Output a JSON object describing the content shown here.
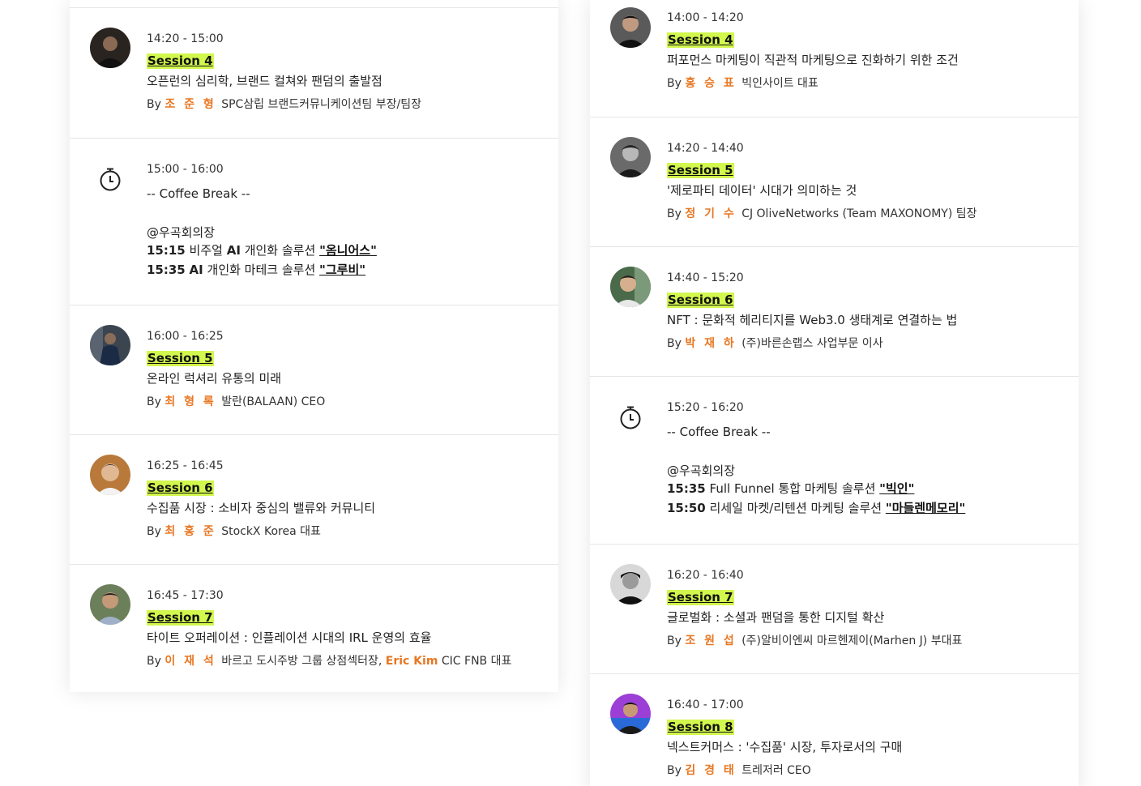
{
  "left": {
    "items": [
      {
        "time": "14:20 - 15:00",
        "session": "Session 4",
        "title": "오픈런의 심리학, 브랜드 컬쳐와 팬덤의 출발점",
        "by": "By",
        "speaker": "조 준 형",
        "role": "SPC삼립 브랜드커뮤니케이션팀 부장/팀장",
        "avatar_bg": "#2a2420"
      },
      {
        "time": "16:00 - 16:25",
        "session": "Session 5",
        "title": "온라인 럭셔리 유통의 미래",
        "by": "By",
        "speaker": "최 형 록",
        "role": "발란(BALAAN) CEO",
        "avatar_bg": "#3b4550"
      },
      {
        "time": "16:25 - 16:45",
        "session": "Session 6",
        "title": "수집품 시장 : 소비자 중심의 밸류와 커뮤니티",
        "by": "By",
        "speaker": "최 홍 준",
        "role": "StockX Korea 대표",
        "avatar_bg": "#b8793a"
      },
      {
        "time": "16:45 - 17:30",
        "session": "Session 7",
        "title": "타이트 오퍼레이션 : 인플레이션 시대의 IRL 운영의 효율",
        "by": "By",
        "speaker": "이 재 석",
        "role": "바르고 도시주방 그룹 상점섹터장,",
        "speaker2": "Eric Kim",
        "role2": "CIC FNB 대표",
        "avatar_bg": "#6b7f5a"
      }
    ],
    "break": {
      "time": "15:00 - 16:00",
      "title": "-- Coffee Break --",
      "venue": "@우곡회의장",
      "promos": [
        {
          "time": "15:15",
          "text_pre": "비주얼",
          "tm": "AI",
          "text_post": "개인화 솔루션",
          "link": "\"옴니어스\""
        },
        {
          "time": "15:35",
          "text_pre": "",
          "tm": "AI",
          "text_post": "개인화 마테크 솔루션",
          "link": "\"그루비\""
        }
      ]
    }
  },
  "right": {
    "items": [
      {
        "time": "14:00 - 14:20",
        "session": "Session 4",
        "title": "퍼포먼스 마케팅이 직관적 마케팅으로 진화하기 위한 조건",
        "by": "By",
        "speaker": "홍 승 표",
        "role": "빅인사이트 대표",
        "avatar_bg": "#2b2b2b"
      },
      {
        "time": "14:20 - 14:40",
        "session": "Session 5",
        "title": "'제로파티 데이터' 시대가 의미하는 것",
        "by": "By",
        "speaker": "정 기 수",
        "role": "CJ OliveNetworks (Team MAXONOMY) 팀장",
        "avatar_bg": "#3a3a3a"
      },
      {
        "time": "14:40 - 15:20",
        "session": "Session 6",
        "title": "NFT : 문화적 헤리티지를 Web3.0 생태계로 연결하는 법",
        "by": "By",
        "speaker": "박 재 하",
        "role": "(주)바른손랩스 사업부문 이사",
        "avatar_bg": "#4a6a4a"
      },
      {
        "time": "16:20 - 16:40",
        "session": "Session 7",
        "title": "글로벌화 : 소셜과 팬덤을 통한 디지털 확산",
        "by": "By",
        "speaker": "조 원 섭",
        "role": "(주)알비이엔씨 마르헨제이(Marhen J) 부대표",
        "avatar_bg": "#d8d8d8"
      },
      {
        "time": "16:40 - 17:00",
        "session": "Session 8",
        "title": "넥스트커머스 : '수집품' 시장, 투자로서의 구매",
        "by": "By",
        "speaker": "김 경 태",
        "role": "트레저러 CEO",
        "avatar_bg": "#9b3fd6"
      }
    ],
    "break": {
      "time": "15:20 - 16:20",
      "title": "-- Coffee Break --",
      "venue": "@우곡회의장",
      "promos": [
        {
          "time": "15:35",
          "text": "Full Funnel 통합 마케팅 솔루션",
          "link": "\"빅인\""
        },
        {
          "time": "15:50",
          "text": "리세일 마켓/리텐션 마케팅 솔루션",
          "link": "\"마들렌메모리\""
        }
      ]
    }
  },
  "colors": {
    "accent": "#e87722",
    "highlight": "#d2f74d"
  },
  "icons": {
    "avatar": "speaker-avatar",
    "break": "stopwatch-icon"
  }
}
